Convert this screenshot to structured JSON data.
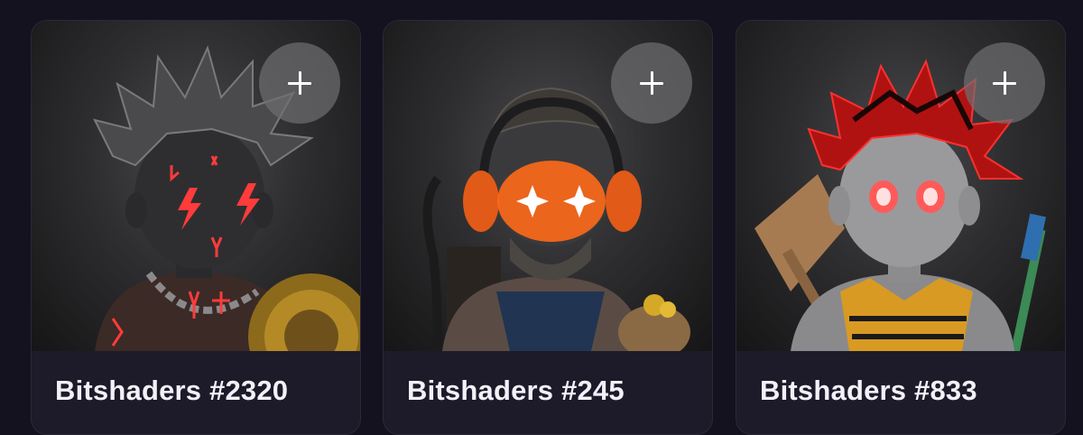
{
  "cards": [
    {
      "title": "Bitshaders #2320",
      "add_label": "+"
    },
    {
      "title": "Bitshaders #245",
      "add_label": "+"
    },
    {
      "title": "Bitshaders #833",
      "add_label": "+"
    }
  ],
  "colors": {
    "page_background": "#15121f",
    "card_background": "#1d1a2a",
    "title_text": "#f2f1f7",
    "glow_red": "#ff3b3b",
    "glow_orange": "#ff6a1a"
  },
  "icons": {
    "add": "plus-icon"
  }
}
